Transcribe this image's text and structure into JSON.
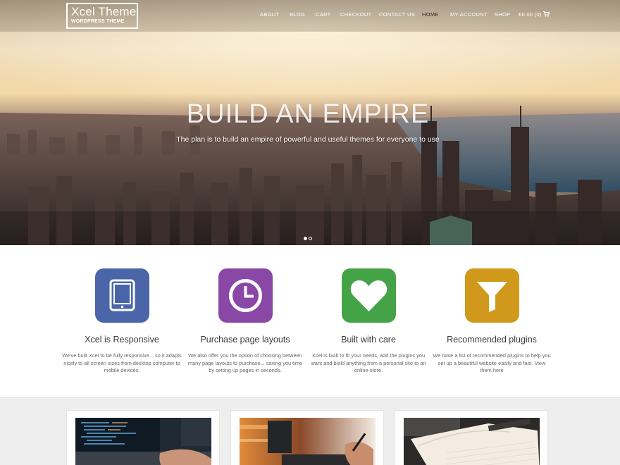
{
  "header": {
    "logo_name": "Xcel Theme",
    "logo_tagline": "WORDPRESS THEME",
    "nav": [
      "ABOUT",
      "BLOG",
      "CART",
      "CHECKOUT",
      "CONTACT US",
      "HOME",
      "MY ACCOUNT",
      "SHOP"
    ],
    "active_nav": "HOME",
    "cart": "£0.00 (0)",
    "cart_icon": "shopping-cart-icon"
  },
  "hero": {
    "title": "BUILD AN EMPIRE",
    "subtitle": "The plan is to build an empire of powerful and useful themes for everyone to use",
    "slide_count": 2,
    "active_slide": 1
  },
  "features": [
    {
      "icon": "tablet-icon",
      "color": "#4a66a8",
      "title": "Xcel is Responsive",
      "desc": "We've built Xcel to be fully responsive... so it adapts nicely to all screen sizes from desktop computer to mobile devices."
    },
    {
      "icon": "clock-icon",
      "color": "#8a48a6",
      "title": "Purchase page layouts",
      "desc": "We also offer you the option of choosing between many page layouts to purchase... saving you time by setting up pages in seconds."
    },
    {
      "icon": "heart-icon",
      "color": "#44a347",
      "title": "Built with care",
      "desc": "Xcel is built to fit your needs, add the plugins you want and build anything from a personal site to an online store."
    },
    {
      "icon": "filter-icon",
      "color": "#d0991c",
      "title": "Recommended plugins",
      "desc": "We have a list of recommended plugins to help you set up a beautiful website easily and fast. View them here"
    }
  ],
  "posts": [
    {
      "image": "laptop-code-photo"
    },
    {
      "image": "drawing-tablet-photo"
    },
    {
      "image": "notebook-photo"
    }
  ]
}
